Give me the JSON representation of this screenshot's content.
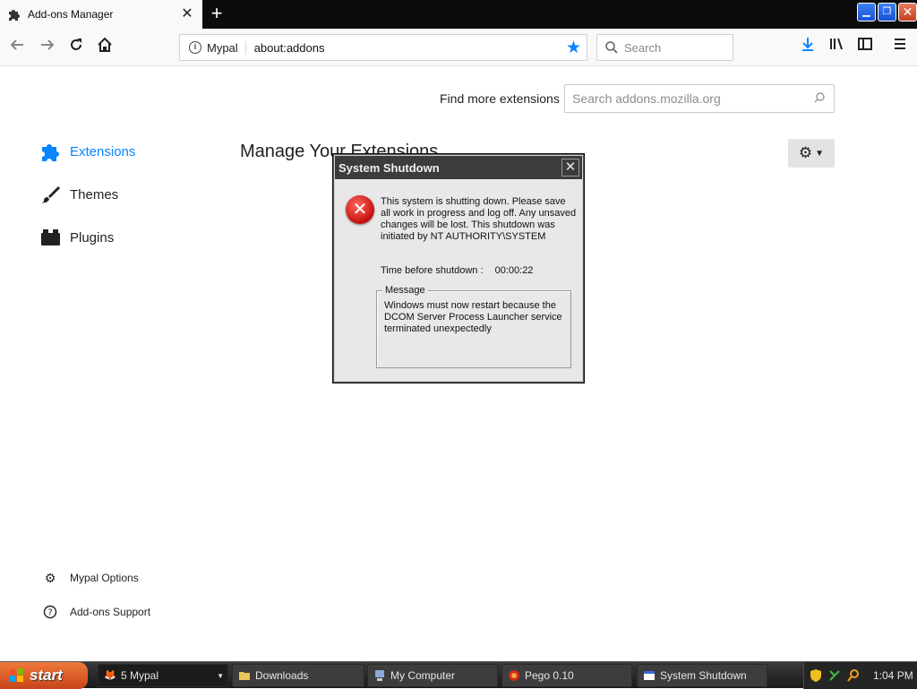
{
  "browser": {
    "tab_title": "Add-ons Manager",
    "new_tab_symbol": "+",
    "identity_label": "Mypal",
    "url": "about:addons",
    "search_placeholder": "Search"
  },
  "page": {
    "find_more_label": "Find more extensions",
    "amo_search_placeholder": "Search addons.mozilla.org",
    "heading": "Manage Your Extensions",
    "categories": [
      {
        "label": "Extensions",
        "icon": "puzzle-icon",
        "selected": true
      },
      {
        "label": "Themes",
        "icon": "brush-icon",
        "selected": false
      },
      {
        "label": "Plugins",
        "icon": "plugin-icon",
        "selected": false
      }
    ],
    "footer": {
      "options_label": "Mypal Options",
      "support_label": "Add-ons Support"
    },
    "accent_color": "#0a84ff"
  },
  "dialog": {
    "title": "System Shutdown",
    "message": "This system is shutting down. Please save all work in progress and log off. Any unsaved changes will be lost. This shutdown was initiated by NT AUTHORITY\\SYSTEM",
    "time_label": "Time before shutdown :",
    "time_value": "00:00:22",
    "group_label": "Message",
    "group_text": "Windows must now restart because the DCOM Server Process Launcher service terminated unexpectedly"
  },
  "taskbar": {
    "start_label": "start",
    "items": [
      {
        "label": "5 Mypal",
        "icon": "mypal-icon"
      },
      {
        "label": "Downloads",
        "icon": "folder-icon"
      },
      {
        "label": "My Computer",
        "icon": "computer-icon"
      },
      {
        "label": "Pego 0.10",
        "icon": "pego-icon"
      },
      {
        "label": "System Shutdown",
        "icon": "window-icon"
      }
    ],
    "clock": "1:04 PM"
  }
}
